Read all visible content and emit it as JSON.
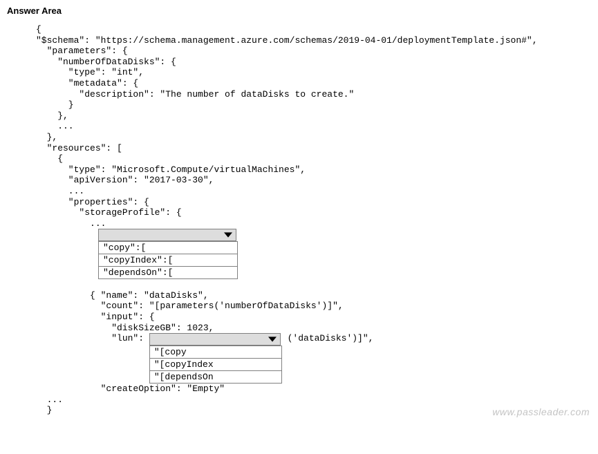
{
  "heading": "Answer Area",
  "code": {
    "l01": "{",
    "l02": "\"$schema\": \"https://schema.management.azure.com/schemas/2019-04-01/deploymentTemplate.json#\",",
    "l03": "  \"parameters\": {",
    "l04": "    \"numberOfDataDisks\": {",
    "l05": "      \"type\": \"int\",",
    "l06": "      \"metadata\": {",
    "l07": "        \"description\": \"The number of dataDisks to create.\"",
    "l08": "      }",
    "l09": "    },",
    "l10": "    ...",
    "l11": "  },",
    "l12": "  \"resources\": [",
    "l13": "    {",
    "l14": "      \"type\": \"Microsoft.Compute/virtualMachines\",",
    "l15": "      \"apiVersion\": \"2017-03-30\",",
    "l16": "      ...",
    "l17": "      \"properties\": {",
    "l18": "        \"storageProfile\": {",
    "l19": "          ...",
    "l20": "",
    "l21": "          { \"name\": \"dataDisks\",",
    "l22": "            \"count\": \"[parameters('numberOfDataDisks')]\",",
    "l23": "            \"input\": {",
    "l24": "              \"diskSizeGB\": 1023,",
    "lun_prefix": "              \"lun\": ",
    "lun_suffix": " ('dataDisks')]\",",
    "l26": "",
    "l27": "            \"createOption\": \"Empty\"",
    "l28": "  ...",
    "l29": "  }"
  },
  "dropdown1": {
    "options": [
      "\"copy\":[",
      "\"copyIndex\":[",
      "\"dependsOn\":["
    ]
  },
  "dropdown2": {
    "options": [
      "\"[copy",
      "\"[copyIndex",
      "\"[dependsOn"
    ]
  },
  "watermark": "www.passleader.com"
}
